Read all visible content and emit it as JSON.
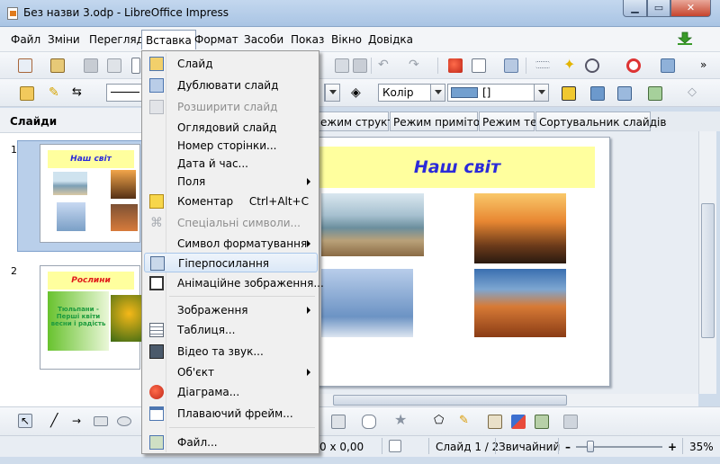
{
  "window": {
    "title": "Без назви 3.odp - LibreOffice Impress"
  },
  "menubar": {
    "items": [
      "Файл",
      "Зміни",
      "Перегляд",
      "Вставка",
      "Формат",
      "Засоби",
      "Показ",
      "Вікно",
      "Довідка"
    ]
  },
  "toolbar2": {
    "color_label": "Колір",
    "fill_value": "[]"
  },
  "slides_pane": {
    "title": "Слайди",
    "slides": [
      {
        "number": "1",
        "title": "Наш світ"
      },
      {
        "number": "2",
        "title": "Рослини",
        "body": "Тюльпани - Перші квіти весни і радість"
      }
    ]
  },
  "view_tabs": [
    "ежим структури",
    "Режим приміток",
    "Режим тез",
    "Сортувальник слайдів"
  ],
  "slide": {
    "title": "Наш світ"
  },
  "insert_menu": {
    "items": [
      {
        "label": "Слайд",
        "icon": "insert-slide-icon"
      },
      {
        "label": "Дублювати слайд",
        "icon": "duplicate-slide-icon"
      },
      {
        "label": "Розширити слайд",
        "disabled": true
      },
      {
        "label": "Оглядовий слайд"
      },
      {
        "label": "Номер сторінки..."
      },
      {
        "label": "Дата й час..."
      },
      {
        "label": "Поля",
        "submenu": true
      },
      {
        "label": "Коментар",
        "shortcut": "Ctrl+Alt+C",
        "icon": "comment-icon"
      },
      {
        "label": "Спеціальні символи...",
        "disabled": true,
        "icon": "special-char-icon"
      },
      {
        "label": "Символ форматування",
        "submenu": true
      },
      {
        "label": "Гіперпосилання",
        "icon": "hyperlink-icon",
        "highlighted": true
      },
      {
        "label": "Анімаційне зображення...",
        "icon": "animated-image-icon"
      },
      {
        "label": "Зображення",
        "submenu": true
      },
      {
        "label": "Таблиця...",
        "icon": "table-icon"
      },
      {
        "label": "Відео та звук...",
        "icon": "video-icon"
      },
      {
        "label": "Об'єкт",
        "submenu": true
      },
      {
        "label": "Діаграма...",
        "icon": "chart-icon"
      },
      {
        "label": "Плаваючий фрейм...",
        "icon": "floating-frame-icon"
      },
      {
        "label": "Файл...",
        "icon": "file-icon"
      }
    ]
  },
  "statusbar": {
    "size": "0 x 0,00",
    "slide": "Слайд 1 / 2",
    "layout": "Звичайний",
    "zoom": "35%"
  },
  "colors": {
    "slide_title": "#2b2ad9",
    "title_fill": "#ffff9e",
    "menu_highlight": "#dbe8f7"
  }
}
